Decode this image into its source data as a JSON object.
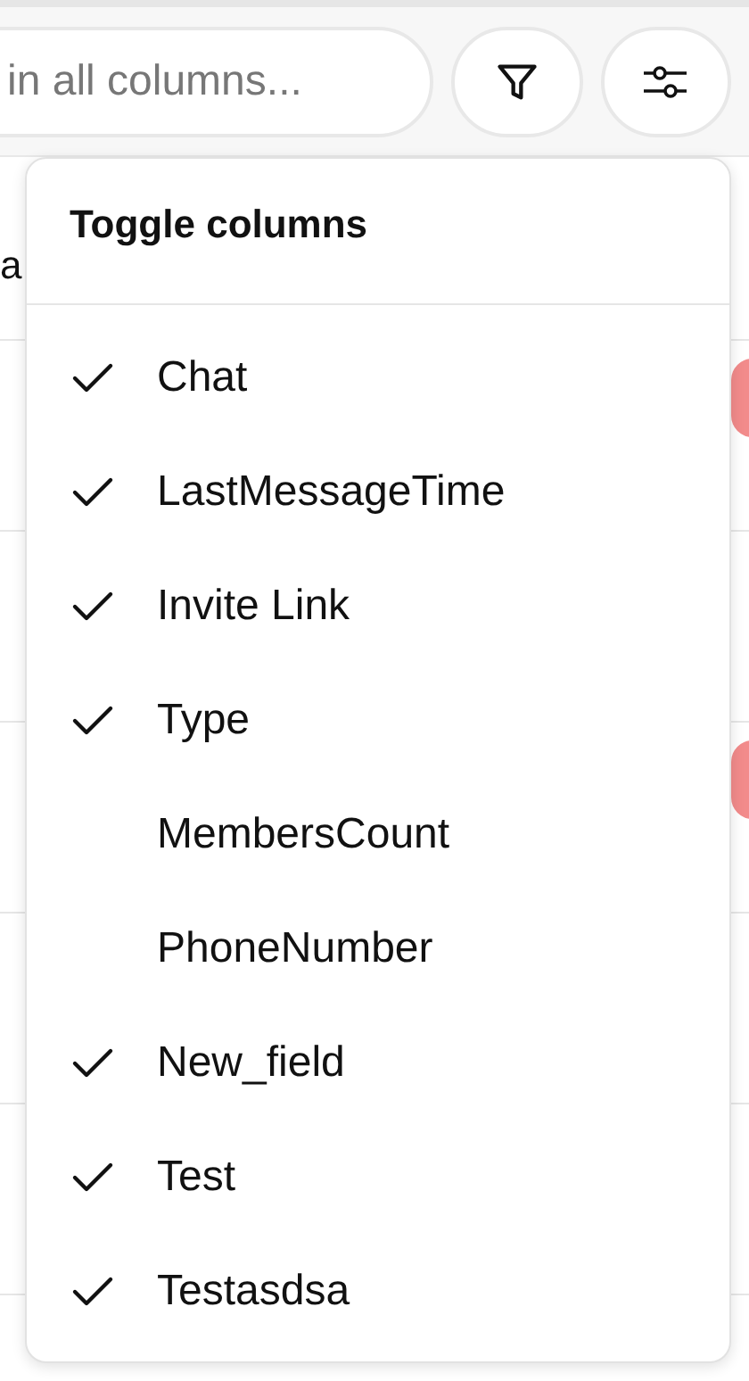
{
  "toolbar": {
    "search": {
      "placeholder": "in all columns..."
    }
  },
  "table": {
    "header_fragment": "a",
    "rows": [
      {
        "badge": true
      },
      {
        "badge": false
      },
      {
        "badge": true
      },
      {
        "badge": false
      },
      {
        "badge": false
      }
    ]
  },
  "menu": {
    "title": "Toggle columns",
    "items": [
      {
        "label": "Chat",
        "checked": true
      },
      {
        "label": "LastMessageTime",
        "checked": true
      },
      {
        "label": "Invite Link",
        "checked": true
      },
      {
        "label": "Type",
        "checked": true
      },
      {
        "label": "MembersCount",
        "checked": false
      },
      {
        "label": "PhoneNumber",
        "checked": false
      },
      {
        "label": "New_field",
        "checked": true
      },
      {
        "label": "Test",
        "checked": true
      },
      {
        "label": "Testasdsa",
        "checked": true
      }
    ]
  }
}
